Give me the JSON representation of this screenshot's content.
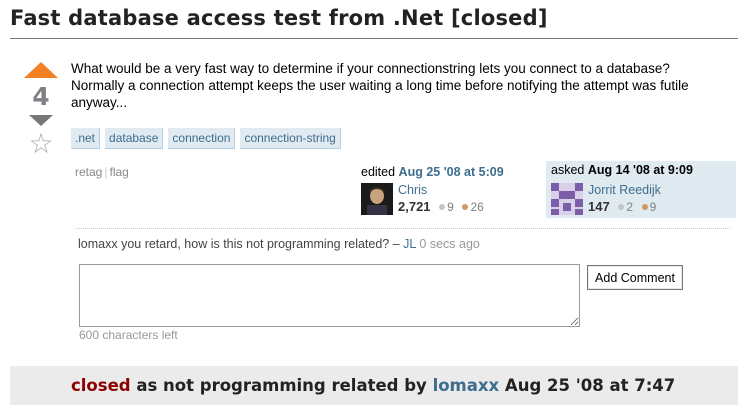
{
  "question": {
    "title": "Fast database access test from .Net [closed]",
    "votes": "4",
    "body": "What would be a very fast way to determine if your connectionstring lets you connect to a database? Normally a connection attempt keeps the user waiting a long time before notifying the attempt was futile anyway...",
    "tags": [
      ".net",
      "database",
      "connection",
      "connection-string"
    ]
  },
  "menu": {
    "retag": "retag",
    "flag": "flag",
    "separator": "|"
  },
  "edited": {
    "prefix": "edited",
    "date": "Aug 25 '08 at 5:09",
    "user": "Chris",
    "rep": "2,721",
    "silver": "9",
    "bronze": "26"
  },
  "asked": {
    "prefix": "asked",
    "date": "Aug 14 '08 at 9:09",
    "user": "Jorrit Reedijk",
    "rep": "147",
    "silver": "2",
    "bronze": "9"
  },
  "comment": {
    "text": "lomaxx you retard, how is this not programming related? – ",
    "user": "JL",
    "time": "0 secs ago"
  },
  "comment_form": {
    "value": "",
    "button": "Add Comment",
    "chars_left": "600 characters left"
  },
  "closed": {
    "keyword": "closed",
    "reason": "as not programming related by",
    "user": "lomaxx",
    "date": "Aug 25 '08 at 7:47"
  }
}
